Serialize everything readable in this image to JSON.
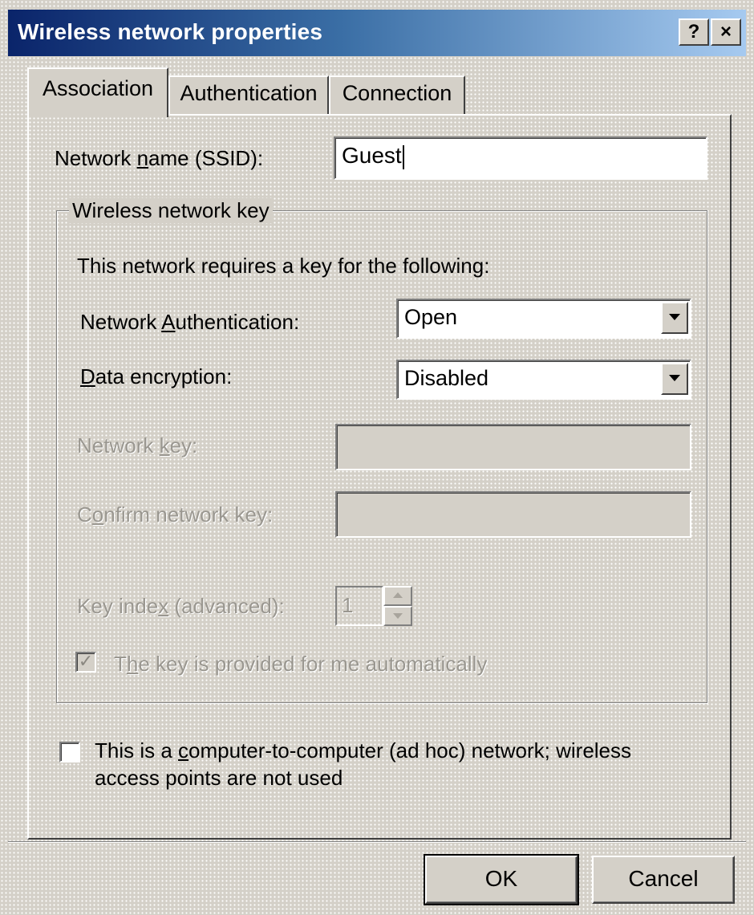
{
  "window": {
    "title": "Wireless network properties",
    "help_glyph": "?",
    "close_glyph": "×"
  },
  "tabs": [
    {
      "label": "Association",
      "active": true
    },
    {
      "label": "Authentication",
      "active": false
    },
    {
      "label": "Connection",
      "active": false
    }
  ],
  "ssid": {
    "label_pre": "Network ",
    "label_accel": "n",
    "label_post": "ame (SSID):",
    "value": "Guest"
  },
  "key_group": {
    "legend": "Wireless network key",
    "description": "This network requires a key for the following:",
    "auth": {
      "label_pre": "Network ",
      "label_accel": "A",
      "label_post": "uthentication:",
      "value": "Open"
    },
    "encryption": {
      "label_pre": "",
      "label_accel": "D",
      "label_post": "ata encryption:",
      "value": "Disabled"
    },
    "network_key": {
      "label_pre": "Network ",
      "label_accel": "k",
      "label_post": "ey:",
      "value": ""
    },
    "confirm_key": {
      "label_pre": "C",
      "label_accel": "o",
      "label_post": "nfirm network key:",
      "value": ""
    },
    "key_index": {
      "label_pre": "Key inde",
      "label_accel": "x",
      "label_post": " (advanced):",
      "value": "1"
    },
    "auto_key": {
      "label_pre": "T",
      "label_accel": "h",
      "label_post": "e key is provided for me automatically",
      "checked": true,
      "check_glyph": "✓"
    }
  },
  "adhoc": {
    "line1_pre": "This is a ",
    "line1_accel": "c",
    "line1_post": "omputer-to-computer (ad hoc) network; wireless",
    "line2": "access points are not used",
    "checked": false
  },
  "buttons": {
    "ok": "OK",
    "cancel": "Cancel"
  }
}
